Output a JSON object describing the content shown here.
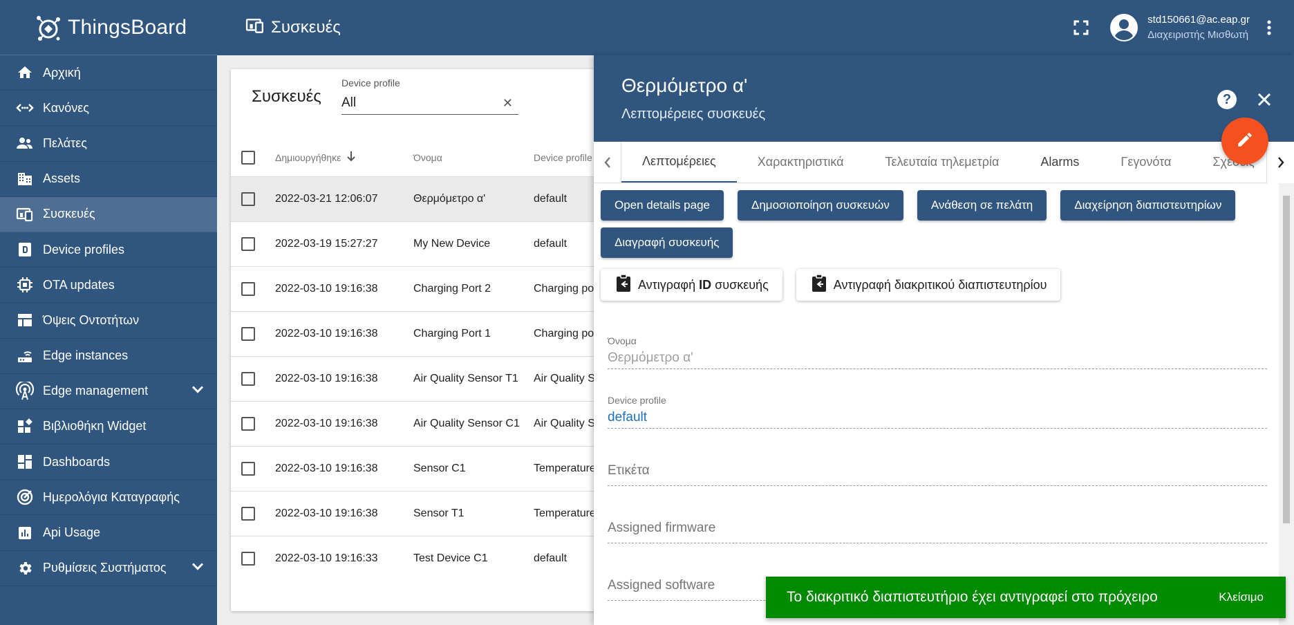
{
  "app": {
    "name": "ThingsBoard"
  },
  "sidebar": {
    "items": [
      {
        "label": "Αρχική",
        "icon": "home-icon"
      },
      {
        "label": "Κανόνες",
        "icon": "rule-chain-icon"
      },
      {
        "label": "Πελάτες",
        "icon": "customers-icon"
      },
      {
        "label": "Assets",
        "icon": "assets-icon"
      },
      {
        "label": "Συσκευές",
        "icon": "devices-icon",
        "active": true
      },
      {
        "label": "Device profiles",
        "icon": "device-profile-icon"
      },
      {
        "label": "OTA updates",
        "icon": "chip-icon"
      },
      {
        "label": "Όψεις Οντοτήτων",
        "icon": "entity-view-icon"
      },
      {
        "label": "Edge instances",
        "icon": "router-icon"
      },
      {
        "label": "Edge management",
        "icon": "antenna-icon",
        "expandable": true
      },
      {
        "label": "Βιβλιοθήκη Widget",
        "icon": "widgets-icon"
      },
      {
        "label": "Dashboards",
        "icon": "dashboard-icon"
      },
      {
        "label": "Ημερολόγια Καταγραφής",
        "icon": "audit-log-icon"
      },
      {
        "label": "Api Usage",
        "icon": "chart-icon"
      },
      {
        "label": "Ρυθμίσεις Συστήματος",
        "icon": "settings-icon",
        "expandable": true
      }
    ]
  },
  "topbar": {
    "title": "Συσκευές",
    "user_email": "std150661@ac.eap.gr",
    "user_role": "Διαχειριστής Μισθωτή"
  },
  "devices_table": {
    "title": "Συσκευές",
    "filter_label": "Device profile",
    "filter_value": "All",
    "columns": [
      "Δημιουργήθηκε",
      "Όνομα",
      "Device profile"
    ],
    "rows": [
      {
        "created": "2022-03-21 12:06:07",
        "name": "Θερμόμετρο α'",
        "profile": "default",
        "selected": true
      },
      {
        "created": "2022-03-19 15:27:27",
        "name": "My New Device",
        "profile": "default"
      },
      {
        "created": "2022-03-10 19:16:38",
        "name": "Charging Port 2",
        "profile": "Charging port"
      },
      {
        "created": "2022-03-10 19:16:38",
        "name": "Charging Port 1",
        "profile": "Charging port"
      },
      {
        "created": "2022-03-10 19:16:38",
        "name": "Air Quality Sensor T1",
        "profile": "Air Quality Sensor"
      },
      {
        "created": "2022-03-10 19:16:38",
        "name": "Air Quality Sensor C1",
        "profile": "Air Quality Sensor"
      },
      {
        "created": "2022-03-10 19:16:38",
        "name": "Sensor C1",
        "profile": "Temperature Sensor"
      },
      {
        "created": "2022-03-10 19:16:38",
        "name": "Sensor T1",
        "profile": "Temperature Sensor"
      },
      {
        "created": "2022-03-10 19:16:33",
        "name": "Test Device C1",
        "profile": "default"
      }
    ]
  },
  "details": {
    "title": "Θερμόμετρο α'",
    "subtitle": "Λεπτομέρειες συσκευές",
    "tabs": [
      "Λεπτομέρειες",
      "Χαρακτηριστικά",
      "Τελευταία τηλεμετρία",
      "Alarms",
      "Γεγονότα",
      "Σχέσεις"
    ],
    "actions": [
      "Open details page",
      "Δημοσιοποίηση συσκευών",
      "Ανάθεση σε πελάτη",
      "Διαχείρηση διαπιστευτηρίων",
      "Διαγραφή συσκευής"
    ],
    "copy_id_label_a": "Αντιγραφή ",
    "copy_id_label_b": "ID",
    "copy_id_label_c": " συσκευής",
    "copy_token_label": "Αντιγραφή διακριτικού διαπιστευτηρίου",
    "fields": {
      "name_label": "Όνομα",
      "name_value": "Θερμόμετρο α'",
      "profile_label": "Device profile",
      "profile_value": "default",
      "label_placeholder": "Ετικέτα",
      "firmware_placeholder": "Assigned firmware",
      "software_placeholder": "Assigned software"
    }
  },
  "snackbar": {
    "message": "Το διακριτικό διαπιστευτήριο έχει αντιγραφεί στο πρόχειρο",
    "action": "Κλείσιμο"
  },
  "colors": {
    "primary": "#305680",
    "accent": "#f4511e",
    "success": "#008a00"
  }
}
